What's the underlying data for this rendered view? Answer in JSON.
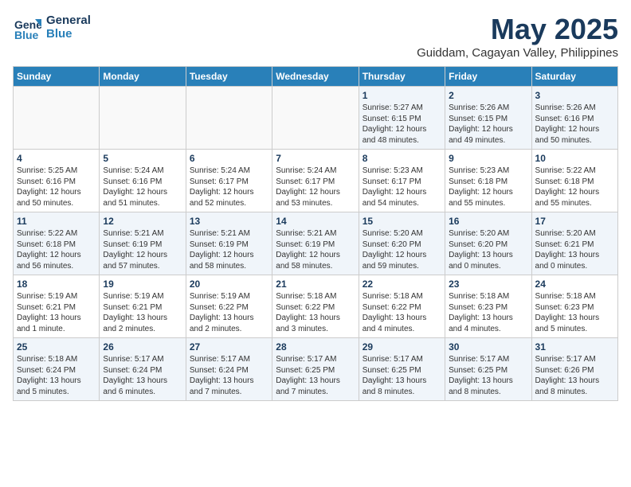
{
  "logo": {
    "line1": "General",
    "line2": "Blue"
  },
  "title": "May 2025",
  "subtitle": "Guiddam, Cagayan Valley, Philippines",
  "days_of_week": [
    "Sunday",
    "Monday",
    "Tuesday",
    "Wednesday",
    "Thursday",
    "Friday",
    "Saturday"
  ],
  "weeks": [
    [
      {
        "day": "",
        "info": ""
      },
      {
        "day": "",
        "info": ""
      },
      {
        "day": "",
        "info": ""
      },
      {
        "day": "",
        "info": ""
      },
      {
        "day": "1",
        "info": "Sunrise: 5:27 AM\nSunset: 6:15 PM\nDaylight: 12 hours\nand 48 minutes."
      },
      {
        "day": "2",
        "info": "Sunrise: 5:26 AM\nSunset: 6:15 PM\nDaylight: 12 hours\nand 49 minutes."
      },
      {
        "day": "3",
        "info": "Sunrise: 5:26 AM\nSunset: 6:16 PM\nDaylight: 12 hours\nand 50 minutes."
      }
    ],
    [
      {
        "day": "4",
        "info": "Sunrise: 5:25 AM\nSunset: 6:16 PM\nDaylight: 12 hours\nand 50 minutes."
      },
      {
        "day": "5",
        "info": "Sunrise: 5:24 AM\nSunset: 6:16 PM\nDaylight: 12 hours\nand 51 minutes."
      },
      {
        "day": "6",
        "info": "Sunrise: 5:24 AM\nSunset: 6:17 PM\nDaylight: 12 hours\nand 52 minutes."
      },
      {
        "day": "7",
        "info": "Sunrise: 5:24 AM\nSunset: 6:17 PM\nDaylight: 12 hours\nand 53 minutes."
      },
      {
        "day": "8",
        "info": "Sunrise: 5:23 AM\nSunset: 6:17 PM\nDaylight: 12 hours\nand 54 minutes."
      },
      {
        "day": "9",
        "info": "Sunrise: 5:23 AM\nSunset: 6:18 PM\nDaylight: 12 hours\nand 55 minutes."
      },
      {
        "day": "10",
        "info": "Sunrise: 5:22 AM\nSunset: 6:18 PM\nDaylight: 12 hours\nand 55 minutes."
      }
    ],
    [
      {
        "day": "11",
        "info": "Sunrise: 5:22 AM\nSunset: 6:18 PM\nDaylight: 12 hours\nand 56 minutes."
      },
      {
        "day": "12",
        "info": "Sunrise: 5:21 AM\nSunset: 6:19 PM\nDaylight: 12 hours\nand 57 minutes."
      },
      {
        "day": "13",
        "info": "Sunrise: 5:21 AM\nSunset: 6:19 PM\nDaylight: 12 hours\nand 58 minutes."
      },
      {
        "day": "14",
        "info": "Sunrise: 5:21 AM\nSunset: 6:19 PM\nDaylight: 12 hours\nand 58 minutes."
      },
      {
        "day": "15",
        "info": "Sunrise: 5:20 AM\nSunset: 6:20 PM\nDaylight: 12 hours\nand 59 minutes."
      },
      {
        "day": "16",
        "info": "Sunrise: 5:20 AM\nSunset: 6:20 PM\nDaylight: 13 hours\nand 0 minutes."
      },
      {
        "day": "17",
        "info": "Sunrise: 5:20 AM\nSunset: 6:21 PM\nDaylight: 13 hours\nand 0 minutes."
      }
    ],
    [
      {
        "day": "18",
        "info": "Sunrise: 5:19 AM\nSunset: 6:21 PM\nDaylight: 13 hours\nand 1 minute."
      },
      {
        "day": "19",
        "info": "Sunrise: 5:19 AM\nSunset: 6:21 PM\nDaylight: 13 hours\nand 2 minutes."
      },
      {
        "day": "20",
        "info": "Sunrise: 5:19 AM\nSunset: 6:22 PM\nDaylight: 13 hours\nand 2 minutes."
      },
      {
        "day": "21",
        "info": "Sunrise: 5:18 AM\nSunset: 6:22 PM\nDaylight: 13 hours\nand 3 minutes."
      },
      {
        "day": "22",
        "info": "Sunrise: 5:18 AM\nSunset: 6:22 PM\nDaylight: 13 hours\nand 4 minutes."
      },
      {
        "day": "23",
        "info": "Sunrise: 5:18 AM\nSunset: 6:23 PM\nDaylight: 13 hours\nand 4 minutes."
      },
      {
        "day": "24",
        "info": "Sunrise: 5:18 AM\nSunset: 6:23 PM\nDaylight: 13 hours\nand 5 minutes."
      }
    ],
    [
      {
        "day": "25",
        "info": "Sunrise: 5:18 AM\nSunset: 6:24 PM\nDaylight: 13 hours\nand 5 minutes."
      },
      {
        "day": "26",
        "info": "Sunrise: 5:17 AM\nSunset: 6:24 PM\nDaylight: 13 hours\nand 6 minutes."
      },
      {
        "day": "27",
        "info": "Sunrise: 5:17 AM\nSunset: 6:24 PM\nDaylight: 13 hours\nand 7 minutes."
      },
      {
        "day": "28",
        "info": "Sunrise: 5:17 AM\nSunset: 6:25 PM\nDaylight: 13 hours\nand 7 minutes."
      },
      {
        "day": "29",
        "info": "Sunrise: 5:17 AM\nSunset: 6:25 PM\nDaylight: 13 hours\nand 8 minutes."
      },
      {
        "day": "30",
        "info": "Sunrise: 5:17 AM\nSunset: 6:25 PM\nDaylight: 13 hours\nand 8 minutes."
      },
      {
        "day": "31",
        "info": "Sunrise: 5:17 AM\nSunset: 6:26 PM\nDaylight: 13 hours\nand 8 minutes."
      }
    ]
  ]
}
